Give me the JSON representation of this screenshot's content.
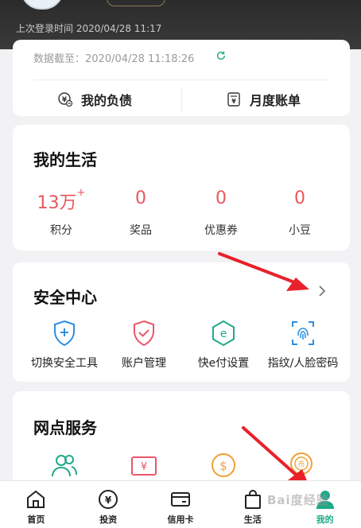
{
  "header": {
    "login_time": "上次登录时间 2020/04/28 11:17"
  },
  "summary": {
    "data_time": "数据截至：2020/04/28 11:18:26",
    "debt_label": "我的负债",
    "bill_label": "月度账单"
  },
  "life": {
    "title": "我的生活",
    "stats": [
      {
        "value": "13万",
        "sup": "+",
        "label": "积分"
      },
      {
        "value": "0",
        "label": "奖品"
      },
      {
        "value": "0",
        "label": "优惠券"
      },
      {
        "value": "0",
        "label": "小豆"
      }
    ]
  },
  "security": {
    "title": "安全中心",
    "tools": [
      {
        "label": "切换安全工具",
        "icon": "shield-plus-icon"
      },
      {
        "label": "账户管理",
        "icon": "shield-check-icon"
      },
      {
        "label": "快e付设置",
        "icon": "hexagon-e-icon"
      },
      {
        "label": "指纹/人脸密码",
        "icon": "fingerprint-icon"
      }
    ]
  },
  "branch": {
    "title": "网点服务",
    "icons": [
      "people-icon",
      "yuan-card-icon",
      "dollar-coin-icon",
      "coin-stack-icon"
    ]
  },
  "tabbar": {
    "tabs": [
      {
        "label": "首页",
        "icon": "home-icon"
      },
      {
        "label": "投资",
        "icon": "yuan-circle-icon"
      },
      {
        "label": "信用卡",
        "icon": "credit-card-icon"
      },
      {
        "label": "生活",
        "icon": "shopping-bag-icon"
      },
      {
        "label": "我的",
        "icon": "person-icon"
      }
    ]
  },
  "watermark": "Bai度经验",
  "colors": {
    "accent": "#21a989",
    "stat_red": "#e9575e",
    "orange": "#f0a030",
    "blue": "#2f8fe0",
    "pink": "#e8576a"
  }
}
